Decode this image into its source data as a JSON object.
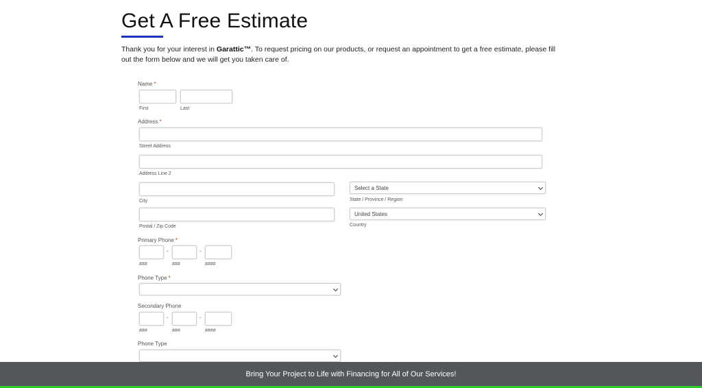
{
  "heading": "Get A Free Estimate",
  "intro": {
    "before": "Thank you for your interest in ",
    "brand": "Garattic™",
    "after": ". To request pricing on our products, or request an appointment to get a free estimate, please fill out the form below and we will get you taken care of."
  },
  "required_mark": "*",
  "form": {
    "name": {
      "label": "Name",
      "first_sub": "First",
      "last_sub": "Last"
    },
    "address": {
      "label": "Address",
      "street_sub": "Street Address",
      "line2_sub": "Address Line 2",
      "city_sub": "City",
      "state_sub": "State / Province / Region",
      "state_selected": "Select a State",
      "zip_sub": "Postal / Zip Code",
      "country_sub": "Country",
      "country_selected": "United States"
    },
    "primary_phone": {
      "label": "Primary Phone",
      "area_sub": "###",
      "prefix_sub": "###",
      "line_sub": "####",
      "sep": "-"
    },
    "phone_type_1": {
      "label": "Phone Type"
    },
    "secondary_phone": {
      "label": "Secondary Phone",
      "area_sub": "###",
      "prefix_sub": "###",
      "line_sub": "####",
      "sep": "-"
    },
    "phone_type_2": {
      "label": "Phone Type"
    }
  },
  "footer": {
    "text": "Bring Your Project to Life with Financing for All of Our Services!"
  },
  "colors": {
    "accent": "#1a33b8",
    "footer_bg": "#53575b",
    "footer_line": "#2ecc2e",
    "required": "#c0392b"
  }
}
